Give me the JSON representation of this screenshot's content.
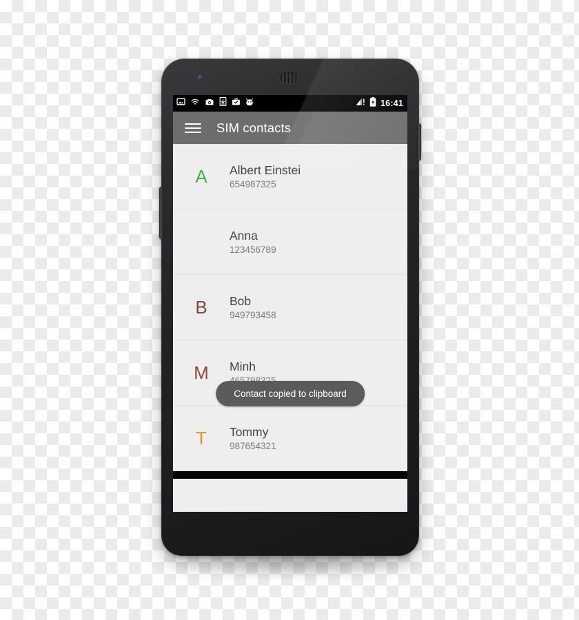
{
  "app": {
    "title": "SIM contacts"
  },
  "status_bar": {
    "clock": "16:41",
    "left_icons": [
      {
        "name": "image-icon"
      },
      {
        "name": "wifi-icon"
      },
      {
        "name": "camera-icon"
      },
      {
        "name": "download-icon"
      },
      {
        "name": "work-briefcase-check-icon"
      },
      {
        "name": "android-head-icon"
      }
    ],
    "right_icons": [
      {
        "name": "signal-no-sim-icon"
      },
      {
        "name": "battery-charging-icon"
      }
    ]
  },
  "toolbar": {
    "menu_icon": "hamburger-menu-icon",
    "title": "SIM contacts"
  },
  "contacts": [
    {
      "index": "A",
      "index_color": "#3cb34a",
      "name": "Albert Einstei",
      "number": "654987325"
    },
    {
      "index": "",
      "index_color": "#3cb34a",
      "name": "Anna",
      "number": "123456789"
    },
    {
      "index": "B",
      "index_color": "#7b4a38",
      "name": "Bob",
      "number": "949793458"
    },
    {
      "index": "M",
      "index_color": "#8a4a33",
      "name": "Minh",
      "number": "465798325"
    },
    {
      "index": "T",
      "index_color": "#ff8c1a",
      "name": "Tommy",
      "number": "987654321"
    }
  ],
  "toast": {
    "message": "Contact copied to clipboard"
  },
  "nav_bar": {
    "back_label": "back-button",
    "home_label": "home-button",
    "recents_label": "recents-button"
  },
  "colors": {
    "screen_bg": "#eeeeee",
    "toolbar_bg": "#6d6d6d",
    "status_bg": "#000000",
    "nav_bg": "#050505",
    "toast_bg": "#5b5b5b",
    "name_text": "#454545",
    "number_text": "#7b7b7b",
    "divider": "#e2e2e2"
  }
}
